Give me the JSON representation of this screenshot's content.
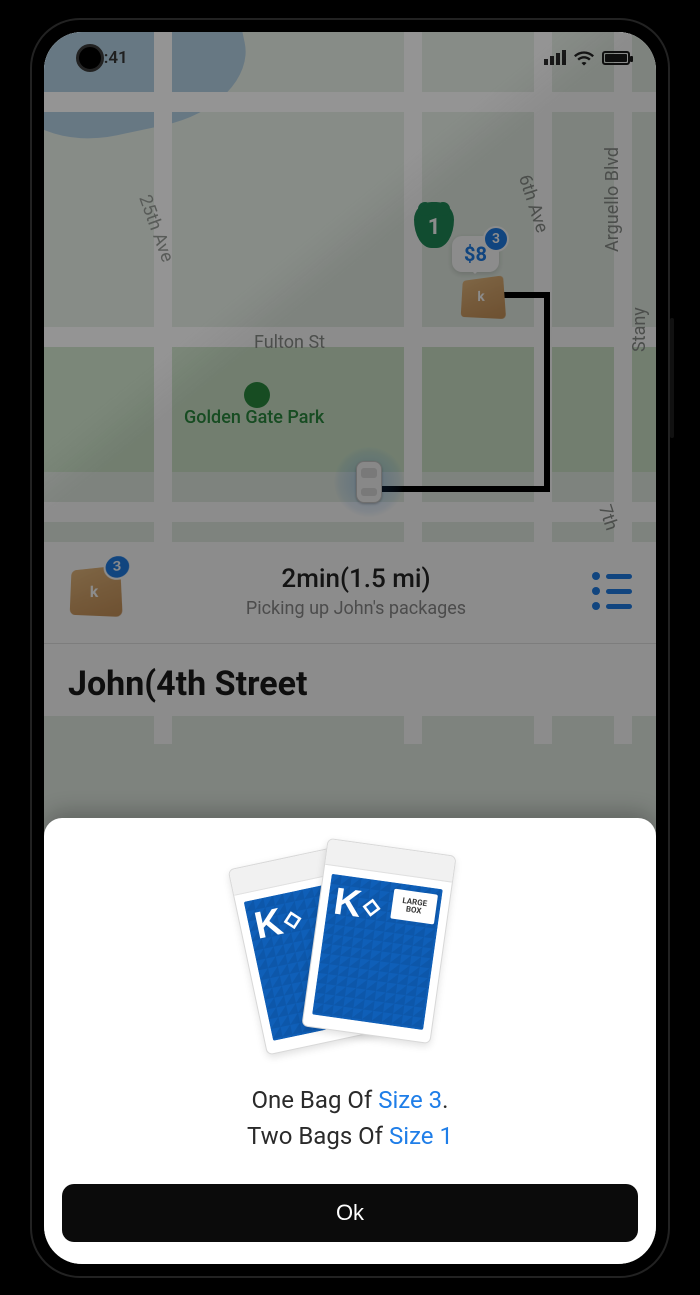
{
  "statusbar": {
    "time": "9:41"
  },
  "map": {
    "streets": {
      "ave25": "25th Ave",
      "ave6": "6th Ave",
      "arguello": "Arguello Blvd",
      "fulton": "Fulton St",
      "ggp": "Golden Gate Park",
      "ave7": "7th",
      "stany": "Stany"
    },
    "route_shield": "1",
    "price_bubble": "$8",
    "price_badge": "3",
    "dest_badge": "3",
    "dest_logo": "k"
  },
  "info": {
    "pkg_badge": "3",
    "pkg_logo": "k",
    "eta": "2min(1.5 mi)",
    "subtitle": "Picking up John's packages",
    "pickup_name": "John(4th Street"
  },
  "sheet": {
    "line1_pre": "One Bag Of ",
    "line1_hl": "Size 3",
    "line1_post": ".",
    "line2_pre": "Two Bags Of ",
    "line2_hl": "Size 1",
    "ok": "Ok",
    "envelope_label1": "LARGE",
    "envelope_label2": "BOX"
  }
}
